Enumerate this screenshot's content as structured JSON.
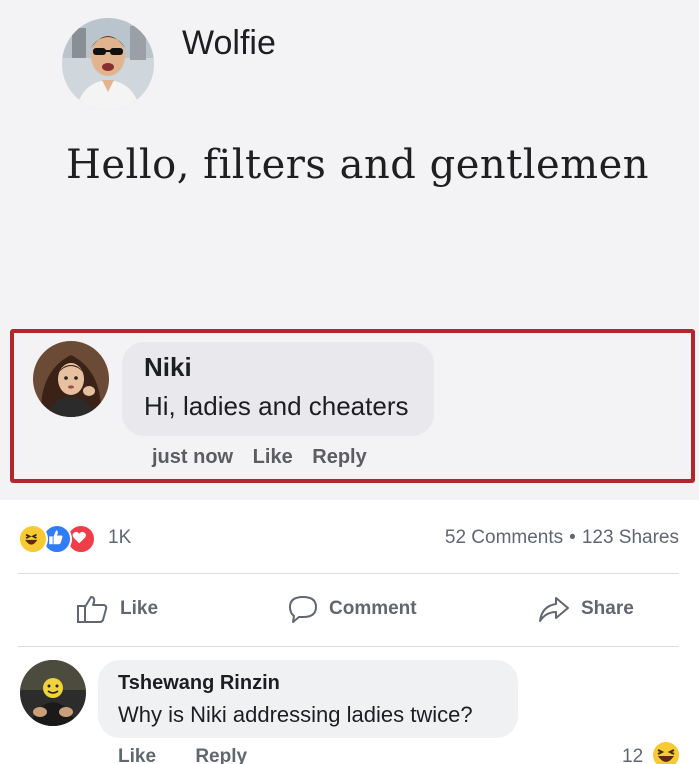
{
  "post": {
    "author": "Wolfie",
    "text": "Hello, filters and gentlemen"
  },
  "highlighted_comment": {
    "author": "Niki",
    "text": "Hi, ladies and cheaters",
    "time": "just now",
    "like_label": "Like",
    "reply_label": "Reply"
  },
  "highlight_color": "#b3262c",
  "reactions": {
    "icons": [
      "haha-icon",
      "like-icon",
      "love-icon"
    ],
    "count": "1K"
  },
  "stats": {
    "comments": "52 Comments",
    "separator": "•",
    "shares": "123 Shares"
  },
  "actions": {
    "like_label": "Like",
    "comment_label": "Comment",
    "share_label": "Share"
  },
  "reply_comment": {
    "author": "Tshewang Rinzin",
    "text": "Why is Niki addressing ladies twice?",
    "like_label": "Like",
    "reply_label": "Reply",
    "reaction_count": "12",
    "reaction_icon": "haha-icon"
  }
}
